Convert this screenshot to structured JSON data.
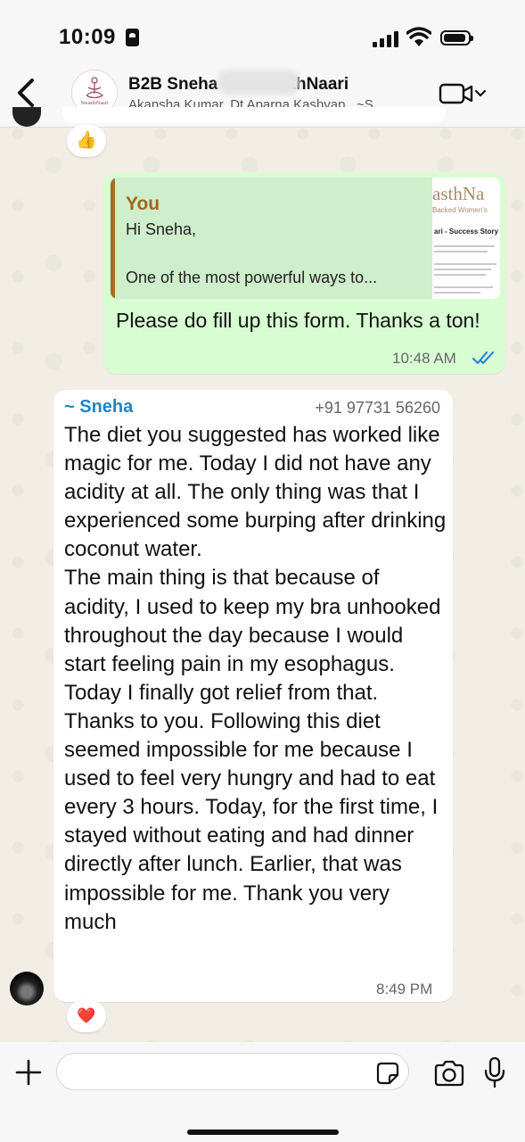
{
  "status_bar": {
    "time": "10:09"
  },
  "header": {
    "title": "B2B Sneha                <> SwasthNaari",
    "subtitle": "Akansha Kumar, Dt Aparna Kashyap , ~S...",
    "avatar_text": "SwasthNaari"
  },
  "messages": {
    "top_reaction": "👍",
    "outgoing": {
      "quote_author": "You",
      "quote_line1": "Hi Sneha,",
      "quote_line2": "One of the most powerful ways to...",
      "thumb_logo": "asthNa",
      "thumb_tagline": "Backed Women's",
      "thumb_heading": "ari - Success Story",
      "text": "Please do fill up this form. Thanks a ton!",
      "time": "10:48 AM",
      "status": "read"
    },
    "incoming": {
      "sender": "~ Sneha",
      "phone": "+91 97731 56260",
      "text": "The diet you suggested has worked like magic for me. Today I did not have any acidity at all. The only thing was that I experienced some burping after drinking coconut water.\nThe main thing is that because of acidity, I used to keep my bra unhooked throughout the day because I would start feeling pain in my esophagus. Today I finally got relief from that. Thanks to you. Following this diet seemed impossible for me because I used to feel very hungry and had to eat every 3 hours. Today, for the first time, I stayed without eating and had dinner directly after lunch. Earlier, that was impossible for me. Thank you very much",
      "time": "8:49 PM",
      "reaction": "❤️"
    }
  },
  "composer": {
    "placeholder": ""
  },
  "colors": {
    "outgoing_bubble": "#d9fdd3",
    "incoming_bubble": "#ffffff",
    "sender_name": "#1a86c4",
    "read_ticks": "#2f86d8",
    "quote_author": "#a0661a"
  },
  "icons": [
    "back-icon",
    "video-call-icon",
    "plus-icon",
    "sticker-icon",
    "camera-icon",
    "mic-icon",
    "read-ticks-icon"
  ]
}
